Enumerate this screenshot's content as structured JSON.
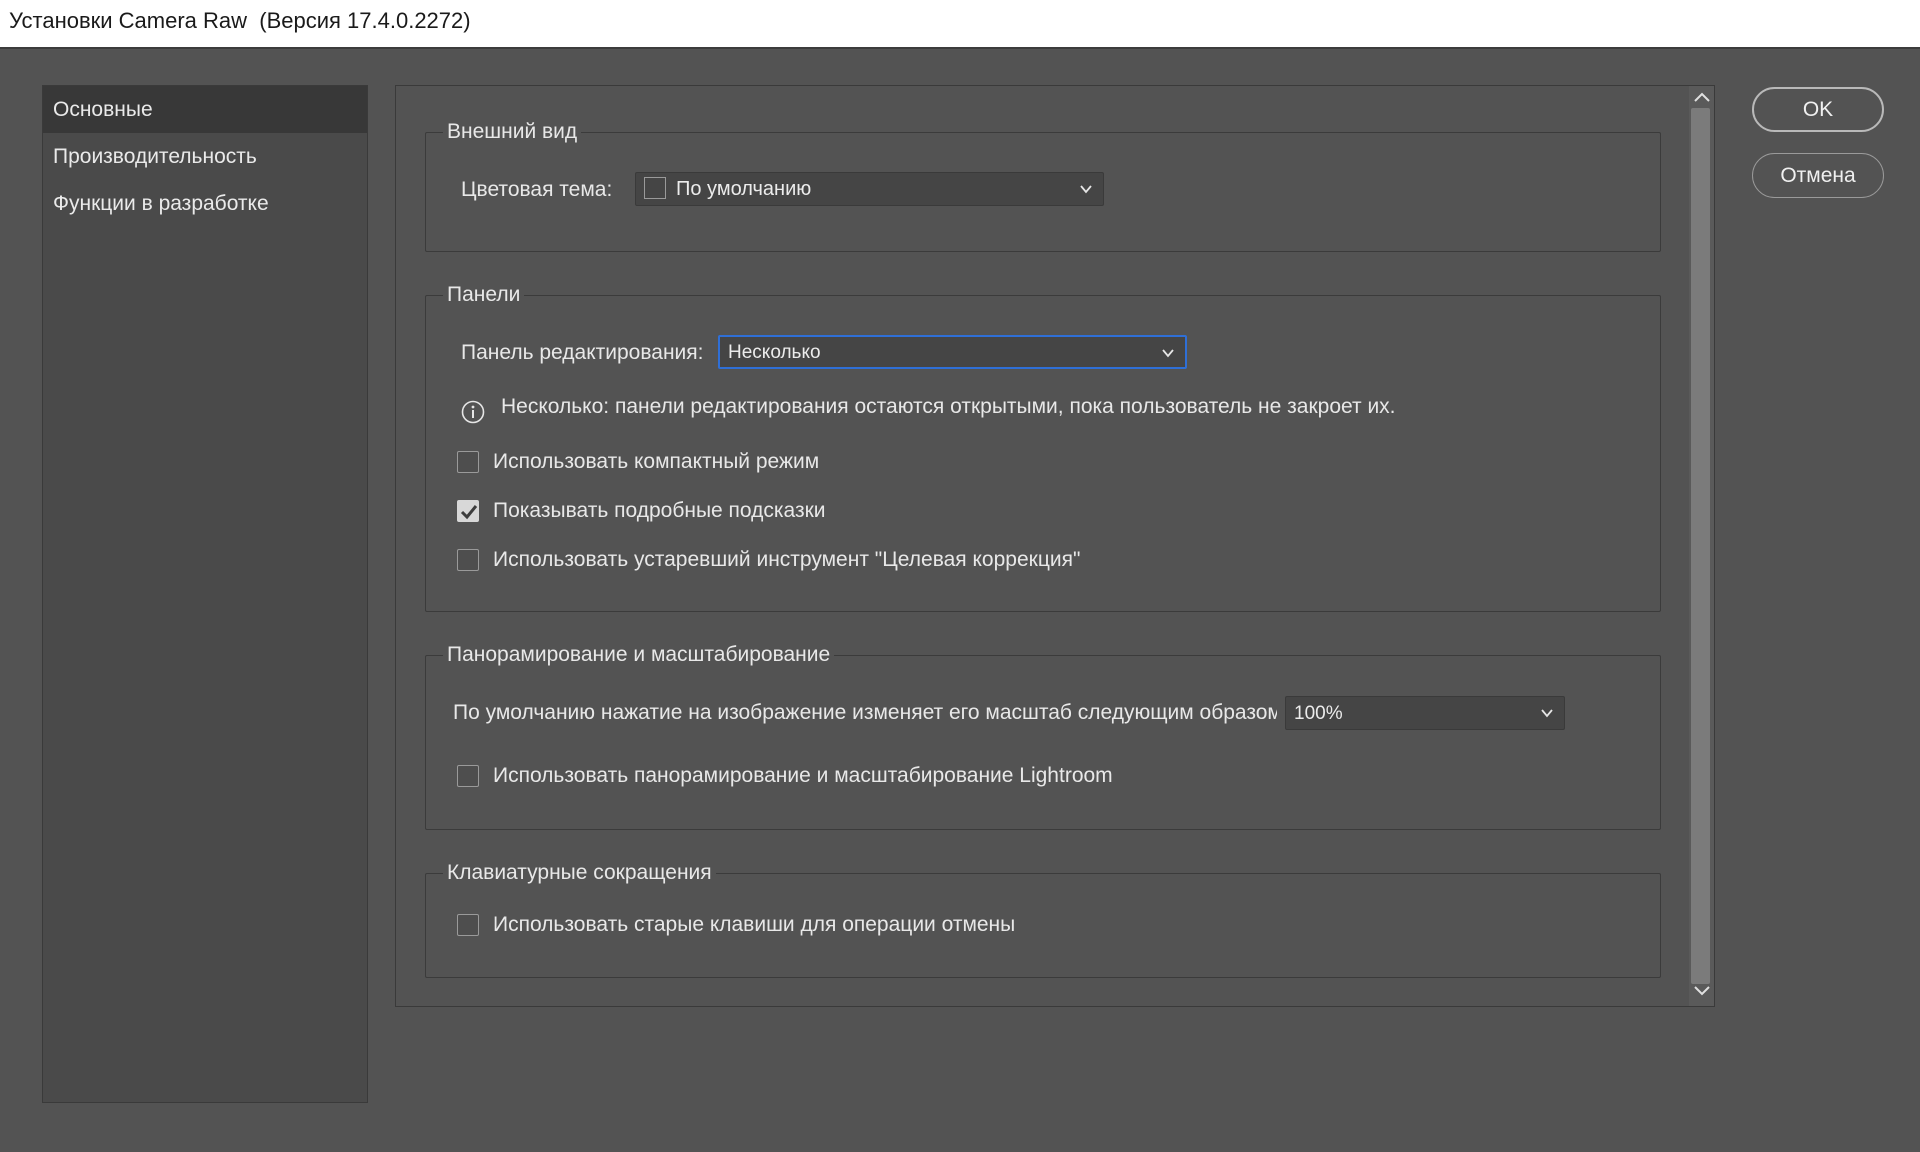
{
  "window": {
    "title": "Установки Camera Raw  (Версия 17.4.0.2272)"
  },
  "sidebar": {
    "items": [
      {
        "label": "Основные",
        "selected": true
      },
      {
        "label": "Производительность"
      },
      {
        "label": "Функции в разработке"
      }
    ]
  },
  "appearance": {
    "legend": "Внешний вид",
    "color_theme_label": "Цветовая тема:",
    "color_theme_value": "По умолчанию"
  },
  "panels": {
    "legend": "Панели",
    "edit_panel_label": "Панель редактирования:",
    "edit_panel_value": "Несколько",
    "info_text": "Несколько: панели редактирования остаются открытыми, пока пользователь не закроет их.",
    "options": [
      {
        "label": "Использовать компактный режим",
        "checked": false
      },
      {
        "label": "Показывать подробные подсказки",
        "checked": true
      },
      {
        "label": "Использовать устаревший инструмент \"Целевая коррекция\"",
        "checked": false
      }
    ]
  },
  "pan_zoom": {
    "legend": "Панорамирование и масштабирование",
    "default_click_label": "По умолчанию нажатие на изображение изменяет его масштаб следующим образом",
    "default_click_value": "100%",
    "lightroom_option": {
      "label": "Использовать панорамирование и масштабирование Lightroom",
      "checked": false
    }
  },
  "shortcuts": {
    "legend": "Клавиатурные сокращения",
    "legacy_undo_option": {
      "label": "Использовать старые клавиши для операции отмены",
      "checked": false
    }
  },
  "buttons": {
    "ok": "OK",
    "cancel": "Отмена"
  },
  "colors": {
    "background": "#535353",
    "focus": "#2f6fd6"
  }
}
